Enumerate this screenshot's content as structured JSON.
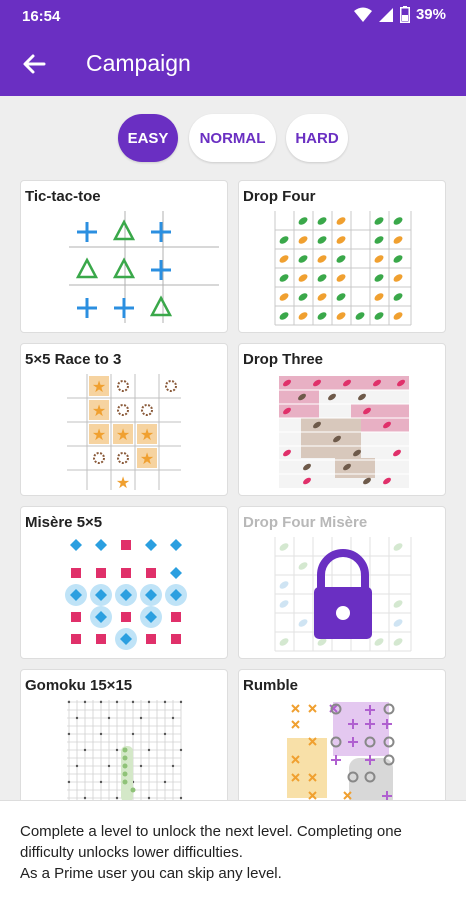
{
  "status_bar": {
    "time": "16:54",
    "battery": "39%"
  },
  "app_bar": {
    "title": "Campaign"
  },
  "tabs": [
    {
      "label": "EASY",
      "active": true
    },
    {
      "label": "NORMAL",
      "active": false
    },
    {
      "label": "HARD",
      "active": false
    }
  ],
  "levels": [
    {
      "title": "Tic-tac-toe",
      "locked": false
    },
    {
      "title": "Drop Four",
      "locked": false
    },
    {
      "title": "5×5 Race to 3",
      "locked": false
    },
    {
      "title": "Drop Three",
      "locked": false
    },
    {
      "title": "Misère 5×5",
      "locked": false
    },
    {
      "title": "Drop Four Misère",
      "locked": true
    },
    {
      "title": "Gomoku 15×15",
      "locked": false
    },
    {
      "title": "Rumble",
      "locked": false
    }
  ],
  "info": {
    "line1": "Complete a level to unlock the next level. Completing one difficulty unlocks lower difficulties.",
    "line2": "As a Prime user you can skip any level."
  },
  "colors": {
    "primary": "#6a2fc2",
    "blue": "#2b8fe0",
    "green": "#3aa84a",
    "orange": "#f0a030",
    "pink": "#e0306a"
  },
  "icons": {
    "back": "arrow-left-icon",
    "lock": "lock-icon",
    "wifi": "wifi-icon",
    "signal": "signal-icon",
    "battery": "battery-icon"
  }
}
